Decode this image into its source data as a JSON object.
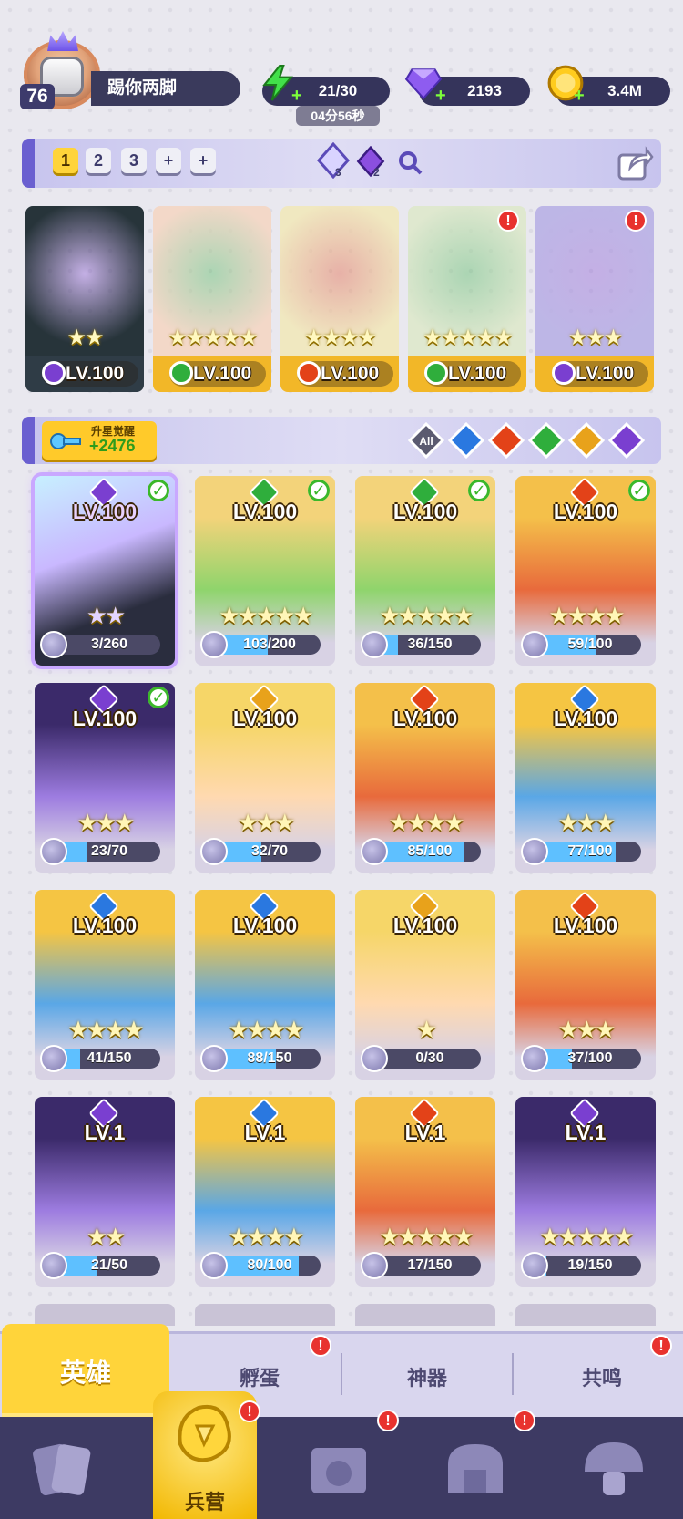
{
  "player": {
    "name": "踢你两脚",
    "level": "76"
  },
  "resources": {
    "energy": "21/30",
    "energy_timer": "04分56秒",
    "gems": "2193",
    "gold": "3.4M"
  },
  "team_bar": {
    "slots": [
      "1",
      "2",
      "3",
      "+",
      "+"
    ],
    "active_slot": "1",
    "currency_a_count": "3",
    "currency_b_count": "2"
  },
  "team": [
    {
      "level": "LV.100",
      "element": "dark",
      "stars": "★★"
    },
    {
      "level": "LV.100",
      "element": "wind",
      "stars": "★★★★★"
    },
    {
      "level": "LV.100",
      "element": "fire",
      "stars": "★★★★"
    },
    {
      "level": "LV.100",
      "element": "wind",
      "stars": "★★★★★",
      "alert": "!"
    },
    {
      "level": "LV.100",
      "element": "dark",
      "stars": "★★★",
      "alert": "!"
    }
  ],
  "awakening": {
    "label": "升星觉醒",
    "value": "+2476"
  },
  "filters": [
    "All",
    "water",
    "fire",
    "wind",
    "light",
    "dark"
  ],
  "heroes": [
    {
      "level": "LV.100",
      "element": "dark",
      "stars": "★★",
      "progress": "3/260",
      "ratio": 0.01,
      "check": true
    },
    {
      "level": "LV.100",
      "element": "wind",
      "stars": "★★★★★",
      "progress": "103/200",
      "ratio": 0.52,
      "check": true
    },
    {
      "level": "LV.100",
      "element": "wind",
      "stars": "★★★★★",
      "progress": "36/150",
      "ratio": 0.24,
      "check": true
    },
    {
      "level": "LV.100",
      "element": "fire",
      "stars": "★★★★",
      "progress": "59/100",
      "ratio": 0.59,
      "check": true
    },
    {
      "level": "LV.100",
      "element": "dark",
      "stars": "★★★",
      "progress": "23/70",
      "ratio": 0.33,
      "check": true
    },
    {
      "level": "LV.100",
      "element": "light",
      "stars": "★★★",
      "progress": "32/70",
      "ratio": 0.46,
      "check": false
    },
    {
      "level": "LV.100",
      "element": "fire",
      "stars": "★★★★",
      "progress": "85/100",
      "ratio": 0.85,
      "check": false
    },
    {
      "level": "LV.100",
      "element": "water",
      "stars": "★★★",
      "progress": "77/100",
      "ratio": 0.77,
      "check": false
    },
    {
      "level": "LV.100",
      "element": "water",
      "stars": "★★★★",
      "progress": "41/150",
      "ratio": 0.27,
      "check": false
    },
    {
      "level": "LV.100",
      "element": "water",
      "stars": "★★★★",
      "progress": "88/150",
      "ratio": 0.59,
      "check": false
    },
    {
      "level": "LV.100",
      "element": "light",
      "stars": "★",
      "progress": "0/30",
      "ratio": 0.0,
      "check": false
    },
    {
      "level": "LV.100",
      "element": "fire",
      "stars": "★★★",
      "progress": "37/100",
      "ratio": 0.37,
      "check": false
    },
    {
      "level": "LV.1",
      "element": "dark",
      "stars": "★★",
      "progress": "21/50",
      "ratio": 0.42,
      "check": false
    },
    {
      "level": "LV.1",
      "element": "water",
      "stars": "★★★★",
      "progress": "80/100",
      "ratio": 0.8,
      "check": false
    },
    {
      "level": "LV.1",
      "element": "fire",
      "stars": "★★★★★",
      "progress": "17/150",
      "ratio": 0.11,
      "check": false
    },
    {
      "level": "LV.1",
      "element": "dark",
      "stars": "★★★★★",
      "progress": "19/150",
      "ratio": 0.13,
      "check": false
    }
  ],
  "tabs": {
    "heroes": "英雄",
    "hatch": "孵蛋",
    "artifact": "神器",
    "resonance": "共鸣"
  },
  "nav": {
    "active_label": "兵营"
  },
  "colors": {
    "dark": "#7a3fd0",
    "wind": "#2fae3c",
    "fire": "#e34218",
    "water": "#2a78e0",
    "light": "#e8a21b"
  }
}
